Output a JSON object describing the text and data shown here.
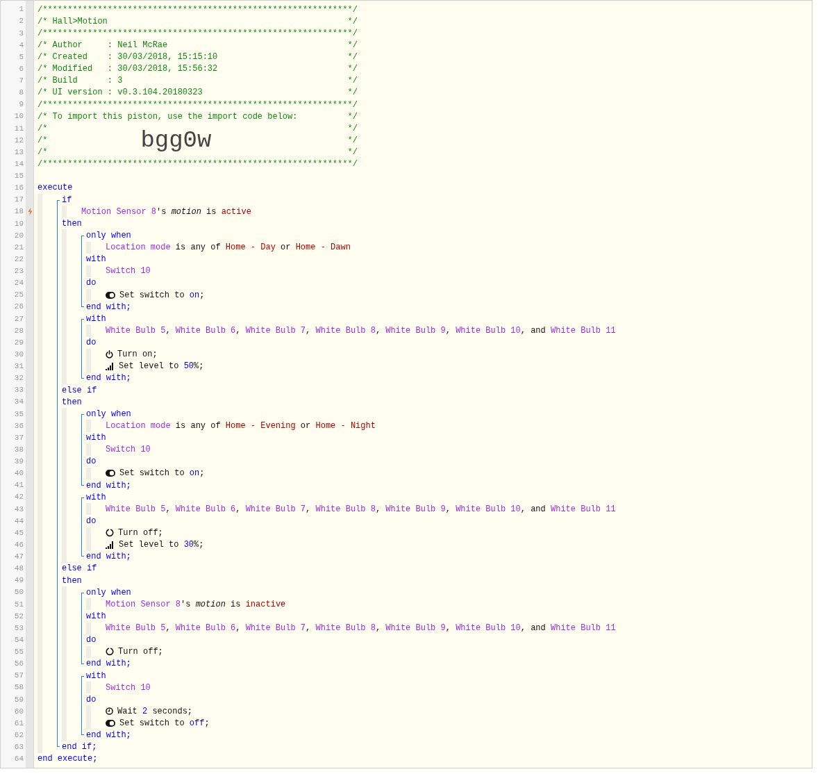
{
  "editor": {
    "items": [
      {
        "kind": "line",
        "number": "1",
        "trigger": false,
        "tokens": [
          {
            "kind": "comment",
            "text": "/**************************************************************/"
          }
        ]
      },
      {
        "kind": "line",
        "number": "2",
        "trigger": false,
        "tokens": [
          {
            "kind": "comment",
            "text": "/* Hall>Motion"
          },
          {
            "kind": "comment-end",
            "text": "*/"
          }
        ]
      },
      {
        "kind": "line",
        "number": "3",
        "trigger": false,
        "tokens": [
          {
            "kind": "comment",
            "text": "/**************************************************************/"
          }
        ]
      },
      {
        "kind": "line",
        "number": "4",
        "trigger": false,
        "tokens": [
          {
            "kind": "comment",
            "text": "/* Author     : Neil McRae"
          },
          {
            "kind": "comment-end",
            "text": "*/"
          }
        ]
      },
      {
        "kind": "line",
        "number": "5",
        "trigger": false,
        "tokens": [
          {
            "kind": "comment",
            "text": "/* Created    : 30/03/2018, 15:15:10"
          },
          {
            "kind": "comment-end",
            "text": "*/"
          }
        ]
      },
      {
        "kind": "line",
        "number": "6",
        "trigger": false,
        "tokens": [
          {
            "kind": "comment",
            "text": "/* Modified   : 30/03/2018, 15:56:32"
          },
          {
            "kind": "comment-end",
            "text": "*/"
          }
        ]
      },
      {
        "kind": "line",
        "number": "7",
        "trigger": false,
        "tokens": [
          {
            "kind": "comment",
            "text": "/* Build      : 3"
          },
          {
            "kind": "comment-end",
            "text": "*/"
          }
        ]
      },
      {
        "kind": "line",
        "number": "8",
        "trigger": false,
        "tokens": [
          {
            "kind": "comment",
            "text": "/* UI version : v0.3.104.20180323"
          },
          {
            "kind": "comment-end",
            "text": "*/"
          }
        ]
      },
      {
        "kind": "line",
        "number": "9",
        "trigger": false,
        "tokens": [
          {
            "kind": "comment",
            "text": "/**************************************************************/"
          }
        ]
      },
      {
        "kind": "line",
        "number": "10",
        "trigger": false,
        "tokens": [
          {
            "kind": "comment",
            "text": "/* To import this piston, use the import code below:"
          },
          {
            "kind": "comment-end",
            "text": "*/"
          }
        ]
      },
      {
        "kind": "line",
        "number": "11",
        "trigger": false,
        "tokens": [
          {
            "kind": "comment",
            "text": "/*"
          },
          {
            "kind": "comment-end",
            "text": "*/"
          }
        ]
      },
      {
        "kind": "line",
        "number": "12",
        "trigger": false,
        "tokens": [
          {
            "kind": "comment",
            "text": "/*"
          },
          {
            "kind": "import-code",
            "text": "bgg0w"
          },
          {
            "kind": "comment-end",
            "text": "*/"
          }
        ]
      },
      {
        "kind": "line",
        "number": "13",
        "trigger": false,
        "tokens": [
          {
            "kind": "comment",
            "text": "/*"
          },
          {
            "kind": "comment-end",
            "text": "*/"
          }
        ]
      },
      {
        "kind": "line",
        "number": "14",
        "trigger": false,
        "tokens": [
          {
            "kind": "comment",
            "text": "/**************************************************************/"
          }
        ]
      },
      {
        "kind": "line",
        "number": "15",
        "trigger": false
      },
      {
        "kind": "line",
        "number": "16",
        "trigger": false,
        "tokens": [
          {
            "kind": "keyword",
            "text": "execute"
          }
        ]
      },
      {
        "kind": "body",
        "children": [
          {
            "kind": "statement",
            "children": [
              {
                "kind": "line",
                "number": "17",
                "trigger": false,
                "tokens": [
                  {
                    "kind": "keyword",
                    "text": "if"
                  }
                ]
              },
              {
                "kind": "body",
                "children": [
                  {
                    "kind": "line",
                    "number": "18",
                    "trigger": true,
                    "tokens": [
                      {
                        "kind": "device",
                        "text": "Motion Sensor 8"
                      },
                      {
                        "kind": "plain",
                        "text": "'s "
                      },
                      {
                        "kind": "attribute",
                        "text": "motion"
                      },
                      {
                        "kind": "plain",
                        "text": " is "
                      },
                      {
                        "kind": "value",
                        "text": "active"
                      }
                    ]
                  }
                ]
              },
              {
                "kind": "line",
                "number": "19",
                "trigger": false,
                "tokens": [
                  {
                    "kind": "keyword",
                    "text": "then"
                  }
                ]
              },
              {
                "kind": "body",
                "children": [
                  {
                    "kind": "statement",
                    "children": [
                      {
                        "kind": "line",
                        "number": "20",
                        "trigger": false,
                        "tokens": [
                          {
                            "kind": "keyword",
                            "text": "only when"
                          }
                        ]
                      },
                      {
                        "kind": "body",
                        "children": [
                          {
                            "kind": "line",
                            "number": "21",
                            "trigger": false,
                            "tokens": [
                              {
                                "kind": "device",
                                "text": "Location mode"
                              },
                              {
                                "kind": "plain",
                                "text": " is any of "
                              },
                              {
                                "kind": "value",
                                "text": "Home - Day"
                              },
                              {
                                "kind": "plain",
                                "text": " or "
                              },
                              {
                                "kind": "value",
                                "text": "Home - Dawn"
                              }
                            ]
                          }
                        ]
                      },
                      {
                        "kind": "line",
                        "number": "22",
                        "trigger": false,
                        "tokens": [
                          {
                            "kind": "keyword",
                            "text": "with"
                          }
                        ]
                      },
                      {
                        "kind": "body",
                        "children": [
                          {
                            "kind": "line",
                            "number": "23",
                            "trigger": false,
                            "tokens": [
                              {
                                "kind": "device",
                                "text": "Switch 10"
                              }
                            ]
                          }
                        ]
                      },
                      {
                        "kind": "line",
                        "number": "24",
                        "trigger": false,
                        "tokens": [
                          {
                            "kind": "keyword",
                            "text": "do"
                          }
                        ]
                      },
                      {
                        "kind": "body",
                        "children": [
                          {
                            "kind": "line",
                            "number": "25",
                            "trigger": false,
                            "tokens": [
                              {
                                "kind": "toggle"
                              },
                              {
                                "kind": "plain",
                                "text": "Set switch to "
                              },
                              {
                                "kind": "literal",
                                "text": "on"
                              },
                              {
                                "kind": "plain",
                                "text": ";"
                              }
                            ]
                          }
                        ]
                      },
                      {
                        "kind": "line",
                        "number": "26",
                        "trigger": false,
                        "tokens": [
                          {
                            "kind": "keyword",
                            "text": "end with;"
                          }
                        ]
                      }
                    ]
                  },
                  {
                    "kind": "statement",
                    "children": [
                      {
                        "kind": "line",
                        "number": "27",
                        "trigger": false,
                        "tokens": [
                          {
                            "kind": "keyword",
                            "text": "with"
                          }
                        ]
                      },
                      {
                        "kind": "body",
                        "children": [
                          {
                            "kind": "line",
                            "number": "28",
                            "trigger": false,
                            "tokens": [
                              {
                                "kind": "device",
                                "text": "White Bulb 5"
                              },
                              {
                                "kind": "plain",
                                "text": ", "
                              },
                              {
                                "kind": "device",
                                "text": "White Bulb 6"
                              },
                              {
                                "kind": "plain",
                                "text": ", "
                              },
                              {
                                "kind": "device",
                                "text": "White Bulb 7"
                              },
                              {
                                "kind": "plain",
                                "text": ", "
                              },
                              {
                                "kind": "device",
                                "text": "White Bulb 8"
                              },
                              {
                                "kind": "plain",
                                "text": ", "
                              },
                              {
                                "kind": "device",
                                "text": "White Bulb 9"
                              },
                              {
                                "kind": "plain",
                                "text": ", "
                              },
                              {
                                "kind": "device",
                                "text": "White Bulb 10"
                              },
                              {
                                "kind": "plain",
                                "text": ", and "
                              },
                              {
                                "kind": "device",
                                "text": "White Bulb 11"
                              }
                            ]
                          }
                        ]
                      },
                      {
                        "kind": "line",
                        "number": "29",
                        "trigger": false,
                        "tokens": [
                          {
                            "kind": "keyword",
                            "text": "do"
                          }
                        ]
                      },
                      {
                        "kind": "body",
                        "children": [
                          {
                            "kind": "line",
                            "number": "30",
                            "trigger": false,
                            "tokens": [
                              {
                                "kind": "power"
                              },
                              {
                                "kind": "plain",
                                "text": "Turn on;"
                              }
                            ]
                          },
                          {
                            "kind": "line",
                            "number": "31",
                            "trigger": false,
                            "tokens": [
                              {
                                "kind": "level"
                              },
                              {
                                "kind": "plain",
                                "text": "Set level to "
                              },
                              {
                                "kind": "literal",
                                "text": "50"
                              },
                              {
                                "kind": "plain",
                                "text": "%;"
                              }
                            ]
                          }
                        ]
                      },
                      {
                        "kind": "line",
                        "number": "32",
                        "trigger": false,
                        "tokens": [
                          {
                            "kind": "keyword",
                            "text": "end with;"
                          }
                        ]
                      }
                    ]
                  }
                ]
              },
              {
                "kind": "line",
                "number": "33",
                "trigger": false,
                "tokens": [
                  {
                    "kind": "keyword",
                    "text": "else if"
                  }
                ]
              },
              {
                "kind": "line",
                "number": "34",
                "trigger": false,
                "tokens": [
                  {
                    "kind": "keyword",
                    "text": "then"
                  }
                ]
              },
              {
                "kind": "body",
                "children": [
                  {
                    "kind": "statement",
                    "children": [
                      {
                        "kind": "line",
                        "number": "35",
                        "trigger": false,
                        "tokens": [
                          {
                            "kind": "keyword",
                            "text": "only when"
                          }
                        ]
                      },
                      {
                        "kind": "body",
                        "children": [
                          {
                            "kind": "line",
                            "number": "36",
                            "trigger": false,
                            "tokens": [
                              {
                                "kind": "device",
                                "text": "Location mode"
                              },
                              {
                                "kind": "plain",
                                "text": " is any of "
                              },
                              {
                                "kind": "value",
                                "text": "Home - Evening"
                              },
                              {
                                "kind": "plain",
                                "text": " or "
                              },
                              {
                                "kind": "value",
                                "text": "Home - Night"
                              }
                            ]
                          }
                        ]
                      },
                      {
                        "kind": "line",
                        "number": "37",
                        "trigger": false,
                        "tokens": [
                          {
                            "kind": "keyword",
                            "text": "with"
                          }
                        ]
                      },
                      {
                        "kind": "body",
                        "children": [
                          {
                            "kind": "line",
                            "number": "38",
                            "trigger": false,
                            "tokens": [
                              {
                                "kind": "device",
                                "text": "Switch 10"
                              }
                            ]
                          }
                        ]
                      },
                      {
                        "kind": "line",
                        "number": "39",
                        "trigger": false,
                        "tokens": [
                          {
                            "kind": "keyword",
                            "text": "do"
                          }
                        ]
                      },
                      {
                        "kind": "body",
                        "children": [
                          {
                            "kind": "line",
                            "number": "40",
                            "trigger": false,
                            "tokens": [
                              {
                                "kind": "toggle"
                              },
                              {
                                "kind": "plain",
                                "text": "Set switch to "
                              },
                              {
                                "kind": "literal",
                                "text": "on"
                              },
                              {
                                "kind": "plain",
                                "text": ";"
                              }
                            ]
                          }
                        ]
                      },
                      {
                        "kind": "line",
                        "number": "41",
                        "trigger": false,
                        "tokens": [
                          {
                            "kind": "keyword",
                            "text": "end with;"
                          }
                        ]
                      }
                    ]
                  },
                  {
                    "kind": "statement",
                    "children": [
                      {
                        "kind": "line",
                        "number": "42",
                        "trigger": false,
                        "tokens": [
                          {
                            "kind": "keyword",
                            "text": "with"
                          }
                        ]
                      },
                      {
                        "kind": "body",
                        "children": [
                          {
                            "kind": "line",
                            "number": "43",
                            "trigger": false,
                            "tokens": [
                              {
                                "kind": "device",
                                "text": "White Bulb 5"
                              },
                              {
                                "kind": "plain",
                                "text": ", "
                              },
                              {
                                "kind": "device",
                                "text": "White Bulb 6"
                              },
                              {
                                "kind": "plain",
                                "text": ", "
                              },
                              {
                                "kind": "device",
                                "text": "White Bulb 7"
                              },
                              {
                                "kind": "plain",
                                "text": ", "
                              },
                              {
                                "kind": "device",
                                "text": "White Bulb 8"
                              },
                              {
                                "kind": "plain",
                                "text": ", "
                              },
                              {
                                "kind": "device",
                                "text": "White Bulb 9"
                              },
                              {
                                "kind": "plain",
                                "text": ", "
                              },
                              {
                                "kind": "device",
                                "text": "White Bulb 10"
                              },
                              {
                                "kind": "plain",
                                "text": ", and "
                              },
                              {
                                "kind": "device",
                                "text": "White Bulb 11"
                              }
                            ]
                          }
                        ]
                      },
                      {
                        "kind": "line",
                        "number": "44",
                        "trigger": false,
                        "tokens": [
                          {
                            "kind": "keyword",
                            "text": "do"
                          }
                        ]
                      },
                      {
                        "kind": "body",
                        "children": [
                          {
                            "kind": "line",
                            "number": "45",
                            "trigger": false,
                            "tokens": [
                              {
                                "kind": "power-off"
                              },
                              {
                                "kind": "plain",
                                "text": "Turn off;"
                              }
                            ]
                          },
                          {
                            "kind": "line",
                            "number": "46",
                            "trigger": false,
                            "tokens": [
                              {
                                "kind": "level"
                              },
                              {
                                "kind": "plain",
                                "text": "Set level to "
                              },
                              {
                                "kind": "literal",
                                "text": "30"
                              },
                              {
                                "kind": "plain",
                                "text": "%;"
                              }
                            ]
                          }
                        ]
                      },
                      {
                        "kind": "line",
                        "number": "47",
                        "trigger": false,
                        "tokens": [
                          {
                            "kind": "keyword",
                            "text": "end with;"
                          }
                        ]
                      }
                    ]
                  }
                ]
              },
              {
                "kind": "line",
                "number": "48",
                "trigger": false,
                "tokens": [
                  {
                    "kind": "keyword",
                    "text": "else if"
                  }
                ]
              },
              {
                "kind": "line",
                "number": "49",
                "trigger": false,
                "tokens": [
                  {
                    "kind": "keyword",
                    "text": "then"
                  }
                ]
              },
              {
                "kind": "body",
                "children": [
                  {
                    "kind": "statement",
                    "children": [
                      {
                        "kind": "line",
                        "number": "50",
                        "trigger": false,
                        "tokens": [
                          {
                            "kind": "keyword",
                            "text": "only when"
                          }
                        ]
                      },
                      {
                        "kind": "body",
                        "children": [
                          {
                            "kind": "line",
                            "number": "51",
                            "trigger": false,
                            "tokens": [
                              {
                                "kind": "device",
                                "text": "Motion Sensor 8"
                              },
                              {
                                "kind": "plain",
                                "text": "'s "
                              },
                              {
                                "kind": "attribute",
                                "text": "motion"
                              },
                              {
                                "kind": "plain",
                                "text": " is "
                              },
                              {
                                "kind": "value",
                                "text": "inactive"
                              }
                            ]
                          }
                        ]
                      },
                      {
                        "kind": "line",
                        "number": "52",
                        "trigger": false,
                        "tokens": [
                          {
                            "kind": "keyword",
                            "text": "with"
                          }
                        ]
                      },
                      {
                        "kind": "body",
                        "children": [
                          {
                            "kind": "line",
                            "number": "53",
                            "trigger": false,
                            "tokens": [
                              {
                                "kind": "device",
                                "text": "White Bulb 5"
                              },
                              {
                                "kind": "plain",
                                "text": ", "
                              },
                              {
                                "kind": "device",
                                "text": "White Bulb 6"
                              },
                              {
                                "kind": "plain",
                                "text": ", "
                              },
                              {
                                "kind": "device",
                                "text": "White Bulb 7"
                              },
                              {
                                "kind": "plain",
                                "text": ", "
                              },
                              {
                                "kind": "device",
                                "text": "White Bulb 8"
                              },
                              {
                                "kind": "plain",
                                "text": ", "
                              },
                              {
                                "kind": "device",
                                "text": "White Bulb 9"
                              },
                              {
                                "kind": "plain",
                                "text": ", "
                              },
                              {
                                "kind": "device",
                                "text": "White Bulb 10"
                              },
                              {
                                "kind": "plain",
                                "text": ", and "
                              },
                              {
                                "kind": "device",
                                "text": "White Bulb 11"
                              }
                            ]
                          }
                        ]
                      },
                      {
                        "kind": "line",
                        "number": "54",
                        "trigger": false,
                        "tokens": [
                          {
                            "kind": "keyword",
                            "text": "do"
                          }
                        ]
                      },
                      {
                        "kind": "body",
                        "children": [
                          {
                            "kind": "line",
                            "number": "55",
                            "trigger": false,
                            "tokens": [
                              {
                                "kind": "power-off"
                              },
                              {
                                "kind": "plain",
                                "text": "Turn off;"
                              }
                            ]
                          }
                        ]
                      },
                      {
                        "kind": "line",
                        "number": "56",
                        "trigger": false,
                        "tokens": [
                          {
                            "kind": "keyword",
                            "text": "end with;"
                          }
                        ]
                      }
                    ]
                  },
                  {
                    "kind": "statement",
                    "children": [
                      {
                        "kind": "line",
                        "number": "57",
                        "trigger": false,
                        "tokens": [
                          {
                            "kind": "keyword",
                            "text": "with"
                          }
                        ]
                      },
                      {
                        "kind": "body",
                        "children": [
                          {
                            "kind": "line",
                            "number": "58",
                            "trigger": false,
                            "tokens": [
                              {
                                "kind": "device",
                                "text": "Switch 10"
                              }
                            ]
                          }
                        ]
                      },
                      {
                        "kind": "line",
                        "number": "59",
                        "trigger": false,
                        "tokens": [
                          {
                            "kind": "keyword",
                            "text": "do"
                          }
                        ]
                      },
                      {
                        "kind": "body",
                        "children": [
                          {
                            "kind": "line",
                            "number": "60",
                            "trigger": false,
                            "tokens": [
                              {
                                "kind": "clock"
                              },
                              {
                                "kind": "plain",
                                "text": "Wait "
                              },
                              {
                                "kind": "literal",
                                "text": "2"
                              },
                              {
                                "kind": "plain",
                                "text": " seconds;"
                              }
                            ]
                          },
                          {
                            "kind": "line",
                            "number": "61",
                            "trigger": false,
                            "tokens": [
                              {
                                "kind": "toggle"
                              },
                              {
                                "kind": "plain",
                                "text": "Set switch to "
                              },
                              {
                                "kind": "literal",
                                "text": "off"
                              },
                              {
                                "kind": "plain",
                                "text": ";"
                              }
                            ]
                          }
                        ]
                      },
                      {
                        "kind": "line",
                        "number": "62",
                        "trigger": false,
                        "tokens": [
                          {
                            "kind": "keyword",
                            "text": "end with;"
                          }
                        ]
                      }
                    ]
                  }
                ]
              },
              {
                "kind": "line",
                "number": "63",
                "trigger": false,
                "tokens": [
                  {
                    "kind": "keyword",
                    "text": "end if;"
                  }
                ]
              }
            ]
          }
        ]
      },
      {
        "kind": "line",
        "number": "64",
        "trigger": false,
        "tokens": [
          {
            "kind": "keyword",
            "text": "end execute;"
          }
        ]
      }
    ]
  }
}
